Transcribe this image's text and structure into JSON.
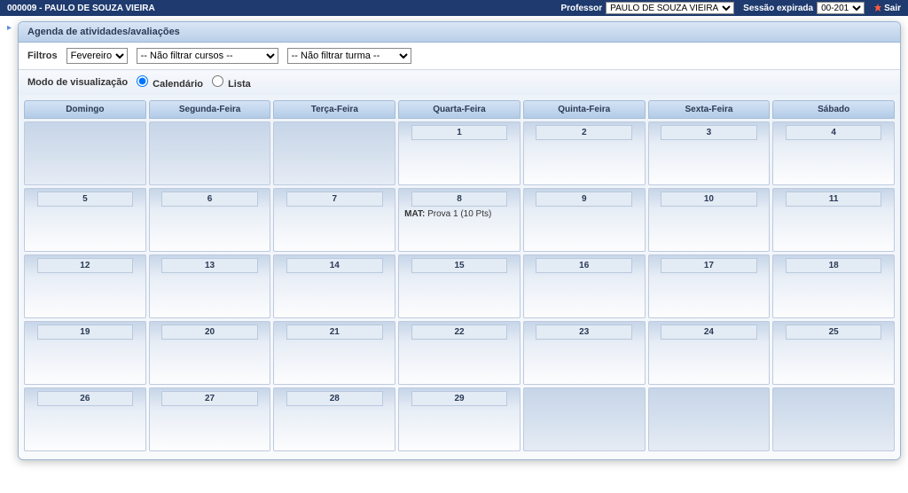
{
  "topbar": {
    "title": "000009 - PAULO DE SOUZA VIEIRA",
    "professor_label": "Professor",
    "professor_value": "PAULO DE SOUZA VIEIRA",
    "session_label": "Sessão expirada",
    "session_value": "00-201",
    "exit_label": "Sair"
  },
  "panel": {
    "title": "Agenda de atividades/avaliações",
    "filters_label": "Filtros",
    "filter_month": "Fevereiro",
    "filter_course": "-- Não filtrar cursos --",
    "filter_class": "-- Não filtrar turma --",
    "viewmode_label": "Modo de visualização",
    "viewmode_cal": "Calendário",
    "viewmode_list": "Lista"
  },
  "calendar": {
    "headers": [
      "Domingo",
      "Segunda-Feira",
      "Terça-Feira",
      "Quarta-Feira",
      "Quinta-Feira",
      "Sexta-Feira",
      "Sábado"
    ],
    "weeks": [
      [
        null,
        null,
        null,
        "1",
        "2",
        "3",
        "4"
      ],
      [
        "5",
        "6",
        "7",
        "8",
        "9",
        "10",
        "11"
      ],
      [
        "12",
        "13",
        "14",
        "15",
        "16",
        "17",
        "18"
      ],
      [
        "19",
        "20",
        "21",
        "22",
        "23",
        "24",
        "25"
      ],
      [
        "26",
        "27",
        "28",
        "29",
        null,
        null,
        null
      ]
    ],
    "events": {
      "8": {
        "subject": "MAT:",
        "text": "Prova 1 (10 Pts)"
      }
    }
  }
}
